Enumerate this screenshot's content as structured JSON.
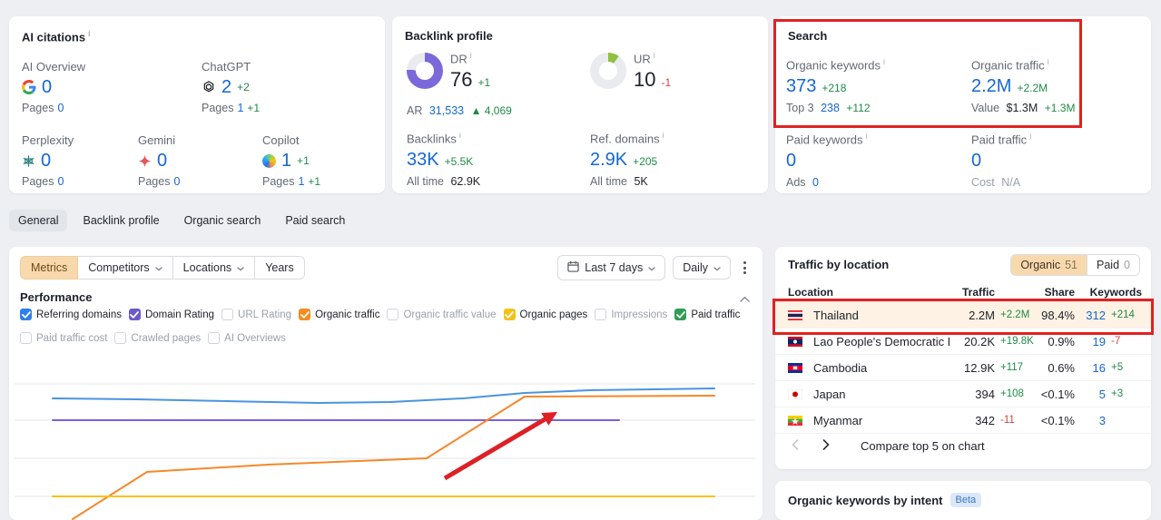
{
  "page": {
    "bg": "#edeff2"
  },
  "colors": {
    "accent_blue": "#1667d2",
    "positive_green": "#208a47",
    "negative_red": "#d6453d",
    "highlight_red": "#e12120",
    "active_orange_bg": "#f8d9ae",
    "row_highlight_bg": "#fdf2e3"
  },
  "cards": {
    "ai_citations": {
      "title": "AI citations",
      "pages_label": "Pages",
      "engines": [
        {
          "name": "AI Overview",
          "icon": "google-icon",
          "value": "0",
          "delta": "",
          "pages": "0",
          "pages_delta": ""
        },
        {
          "name": "ChatGPT",
          "icon": "openai-icon",
          "value": "2",
          "delta": "+2",
          "pages": "1",
          "pages_delta": "+1"
        },
        {
          "name": "Perplexity",
          "icon": "perplexity-icon",
          "value": "0",
          "delta": "",
          "pages": "0",
          "pages_delta": ""
        },
        {
          "name": "Gemini",
          "icon": "gemini-icon",
          "value": "0",
          "delta": "",
          "pages": "0",
          "pages_delta": ""
        },
        {
          "name": "Copilot",
          "icon": "copilot-icon",
          "value": "1",
          "delta": "+1",
          "pages": "1",
          "pages_delta": "+1"
        }
      ]
    },
    "backlink_profile": {
      "title": "Backlink profile",
      "dr": {
        "label": "DR",
        "value": "76",
        "delta": "+1",
        "percent": 76,
        "color": "#7b68d9"
      },
      "ar": {
        "label": "AR",
        "value": "31,533",
        "delta": "▲ 4,069"
      },
      "ur": {
        "label": "UR",
        "value": "10",
        "delta": "-1",
        "percent": 10,
        "color": "#8fc043"
      },
      "backlinks": {
        "label": "Backlinks",
        "value": "33K",
        "delta": "+5.5K",
        "alltime_label": "All time",
        "alltime": "62.9K"
      },
      "ref_domains": {
        "label": "Ref. domains",
        "value": "2.9K",
        "delta": "+205",
        "alltime_label": "All time",
        "alltime": "5K"
      }
    },
    "search": {
      "title": "Search",
      "organic_keywords": {
        "label": "Organic keywords",
        "value": "373",
        "delta": "+218",
        "sub_label": "Top 3",
        "sub_value": "238",
        "sub_delta": "+112"
      },
      "organic_traffic": {
        "label": "Organic traffic",
        "value": "2.2M",
        "delta": "+2.2M",
        "sub_label": "Value",
        "sub_value": "$1.3M",
        "sub_delta": "+1.3M"
      },
      "paid_keywords": {
        "label": "Paid keywords",
        "value": "0",
        "sub_label": "Ads",
        "sub_value": "0"
      },
      "paid_traffic": {
        "label": "Paid traffic",
        "value": "0",
        "sub_label": "Cost",
        "sub_value": "N/A"
      }
    }
  },
  "tabs": [
    {
      "label": "General",
      "active": true
    },
    {
      "label": "Backlink profile",
      "active": false
    },
    {
      "label": "Organic search",
      "active": false
    },
    {
      "label": "Paid search",
      "active": false
    }
  ],
  "left_panel": {
    "controls": {
      "segments": [
        {
          "label": "Metrics",
          "active": true,
          "chevron": false
        },
        {
          "label": "Competitors",
          "active": false,
          "chevron": true
        },
        {
          "label": "Locations",
          "active": false,
          "chevron": true
        },
        {
          "label": "Years",
          "active": false,
          "chevron": false
        }
      ],
      "date_range": "Last 7 days",
      "granularity": "Daily"
    },
    "performance": {
      "title": "Performance",
      "metric_rows": [
        [
          {
            "label": "Referring domains",
            "checked": true,
            "color": "#2f7ef0"
          },
          {
            "label": "Domain Rating",
            "checked": true,
            "color": "#6a5acd"
          },
          {
            "label": "URL Rating",
            "checked": false
          },
          {
            "label": "Organic traffic",
            "checked": true,
            "color": "#f78b1e"
          },
          {
            "label": "Organic traffic value",
            "checked": false
          },
          {
            "label": "Organic pages",
            "checked": true,
            "color": "#f3c219"
          },
          {
            "label": "Impressions",
            "checked": false
          },
          {
            "label": "Paid traffic",
            "checked": true,
            "color": "#2e9e53"
          }
        ],
        [
          {
            "label": "Paid traffic cost",
            "checked": false
          },
          {
            "label": "Crawled pages",
            "checked": false
          },
          {
            "label": "AI Overviews",
            "checked": false
          }
        ]
      ]
    }
  },
  "chart_data": {
    "type": "line",
    "title": "Performance",
    "x_range": "Last 7 days, daily",
    "xlabel": "",
    "ylabel": "",
    "grid": true,
    "legend_position": "checkbox toggles above chart",
    "note": "No axis tick labels are visible in the screenshot; series are given as polylines in plot pixel space (viewBox 830x178, y-down) matching the rendered curves.",
    "gridlines_y": [
      28,
      68,
      110,
      152
    ],
    "series": [
      {
        "name": "Referring domains",
        "color": "#4a94e0",
        "points": [
          [
            48,
            44
          ],
          [
            140,
            45
          ],
          [
            240,
            47
          ],
          [
            340,
            49
          ],
          [
            420,
            48
          ],
          [
            500,
            44
          ],
          [
            568,
            38
          ],
          [
            640,
            35
          ],
          [
            710,
            34
          ],
          [
            777,
            33
          ]
        ]
      },
      {
        "name": "Domain Rating",
        "color": "#7b61d6",
        "points": [
          [
            48,
            68
          ],
          [
            672,
            68
          ]
        ]
      },
      {
        "name": "Organic traffic",
        "color": "#f6882a",
        "points": [
          [
            70,
            177
          ],
          [
            152,
            125
          ],
          [
            285,
            117
          ],
          [
            460,
            110
          ],
          [
            568,
            42
          ],
          [
            777,
            41
          ]
        ]
      },
      {
        "name": "Organic pages",
        "color": "#f8c21a",
        "points": [
          [
            48,
            152
          ],
          [
            777,
            152
          ]
        ]
      }
    ],
    "annotation_arrow": {
      "color": "#dd2025",
      "from": [
        480,
        132
      ],
      "to": [
        592,
        66
      ]
    }
  },
  "traffic_by_location": {
    "title": "Traffic by location",
    "toggle": [
      {
        "label": "Organic",
        "count": "51",
        "active": true
      },
      {
        "label": "Paid",
        "count": "0",
        "active": false
      }
    ],
    "columns": [
      "Location",
      "Traffic",
      "Share",
      "Keywords"
    ],
    "rows": [
      {
        "flag": "flag-thailand",
        "location": "Thailand",
        "traffic": "2.2M",
        "traffic_delta": "+2.2M",
        "share": "98.4%",
        "keywords": "312",
        "keywords_delta": "+214",
        "highlighted": true
      },
      {
        "flag": "flag-laos",
        "location": "Lao People's Democratic Reput",
        "traffic": "20.2K",
        "traffic_delta": "+19.8K",
        "share": "0.9%",
        "keywords": "19",
        "keywords_delta": "-7",
        "highlighted": false
      },
      {
        "flag": "flag-cambodia",
        "location": "Cambodia",
        "traffic": "12.9K",
        "traffic_delta": "+117",
        "share": "0.6%",
        "keywords": "16",
        "keywords_delta": "+5",
        "highlighted": false
      },
      {
        "flag": "flag-japan",
        "location": "Japan",
        "traffic": "394",
        "traffic_delta": "+108",
        "share": "<0.1%",
        "keywords": "5",
        "keywords_delta": "+3",
        "highlighted": false
      },
      {
        "flag": "flag-myanmar",
        "location": "Myanmar",
        "traffic": "342",
        "traffic_delta": "-11",
        "share": "<0.1%",
        "keywords": "3",
        "keywords_delta": "",
        "highlighted": false
      }
    ],
    "footer": {
      "compare_label": "Compare top 5 on chart"
    }
  },
  "organic_keywords_by_intent": {
    "title": "Organic keywords by intent",
    "badge": "Beta"
  }
}
